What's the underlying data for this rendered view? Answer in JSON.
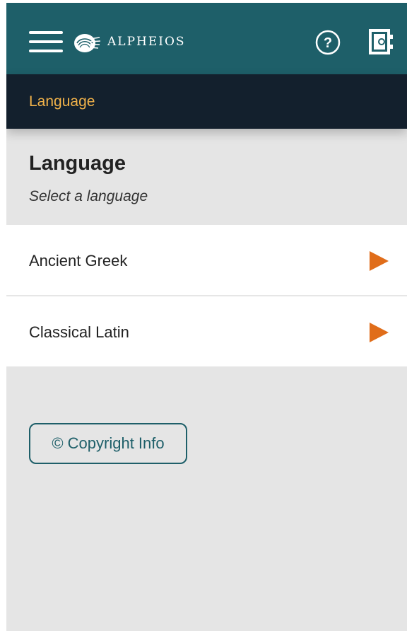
{
  "header": {
    "logo_text": "ALPHEIOS",
    "help_label": "?",
    "colors": {
      "topbar": "#1e5f69",
      "subbar": "#13202d",
      "accent": "#f1b24a",
      "arrow": "#e06d1a"
    }
  },
  "breadcrumb": {
    "title": "Language"
  },
  "main": {
    "heading": "Language",
    "subheading": "Select a language",
    "languages": [
      {
        "label": "Ancient Greek",
        "icon": "play-arrow-icon"
      },
      {
        "label": "Classical Latin",
        "icon": "play-arrow-icon"
      }
    ],
    "copyright_button": "© Copyright Info"
  }
}
